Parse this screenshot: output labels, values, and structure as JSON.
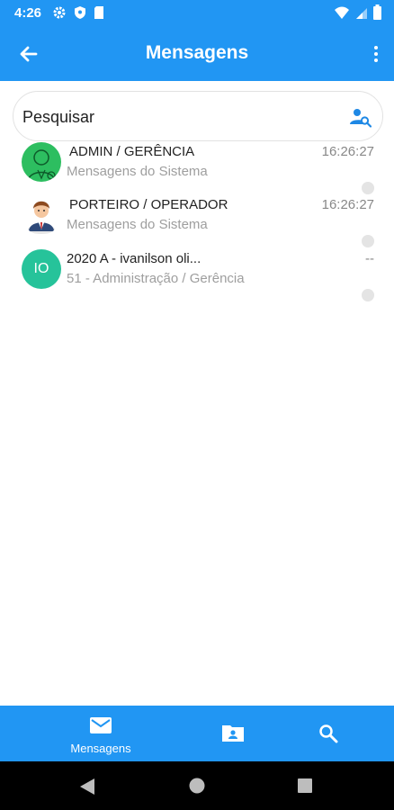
{
  "status_bar": {
    "time": "4:26"
  },
  "app_bar": {
    "title": "Mensagens"
  },
  "search": {
    "placeholder": "Pesquisar"
  },
  "messages": [
    {
      "name": "ADMIN / GERÊNCIA",
      "subtitle": "Mensagens do Sistema",
      "time": "16:26:27",
      "avatar": "admin-avatar-icon"
    },
    {
      "name": "PORTEIRO / OPERADOR",
      "subtitle": "Mensagens do Sistema",
      "time": "16:26:27",
      "avatar": "doorman-avatar-icon"
    },
    {
      "name": "2020 A - ivanilson oli...",
      "subtitle": "51 - Administração / Gerência",
      "time": "--",
      "initials": "IO"
    }
  ],
  "bottom_nav": {
    "messages_label": "Mensagens"
  },
  "colors": {
    "primary": "#2196F3",
    "initials_avatar": "#26C39A",
    "admin_avatar": "#2DBE60"
  }
}
